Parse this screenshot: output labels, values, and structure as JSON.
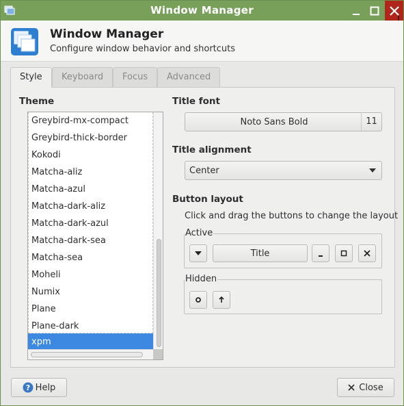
{
  "window": {
    "title": "Window Manager",
    "minimize_icon": "minimize-icon",
    "maximize_icon": "maximize-icon",
    "close_icon": "close-icon"
  },
  "header": {
    "title": "Window Manager",
    "subtitle": "Configure window behavior and shortcuts"
  },
  "tabs": [
    {
      "label": "Style",
      "active": true
    },
    {
      "label": "Keyboard",
      "active": false
    },
    {
      "label": "Focus",
      "active": false
    },
    {
      "label": "Advanced",
      "active": false
    }
  ],
  "style": {
    "theme_label": "Theme",
    "themes": [
      "Greybird-mx-compact",
      "Greybird-thick-border",
      "Kokodi",
      "Matcha-aliz",
      "Matcha-azul",
      "Matcha-dark-aliz",
      "Matcha-dark-azul",
      "Matcha-dark-sea",
      "Matcha-sea",
      "Moheli",
      "Numix",
      "Plane",
      "Plane-dark",
      "xpm"
    ],
    "selected_theme": "xpm",
    "title_font_label": "Title font",
    "title_font_name": "Noto Sans Bold",
    "title_font_size": "11",
    "title_alignment_label": "Title alignment",
    "title_alignment_value": "Center",
    "button_layout_label": "Button layout",
    "button_layout_desc": "Click and drag the buttons to change the layout",
    "active_label": "Active",
    "hidden_label": "Hidden",
    "active_title_button": "Title"
  },
  "footer": {
    "help_label": "Help",
    "close_label": "Close"
  },
  "colors": {
    "titlebar": "#78a05a",
    "close_button": "#b1261b",
    "selection": "#3d88e0"
  }
}
